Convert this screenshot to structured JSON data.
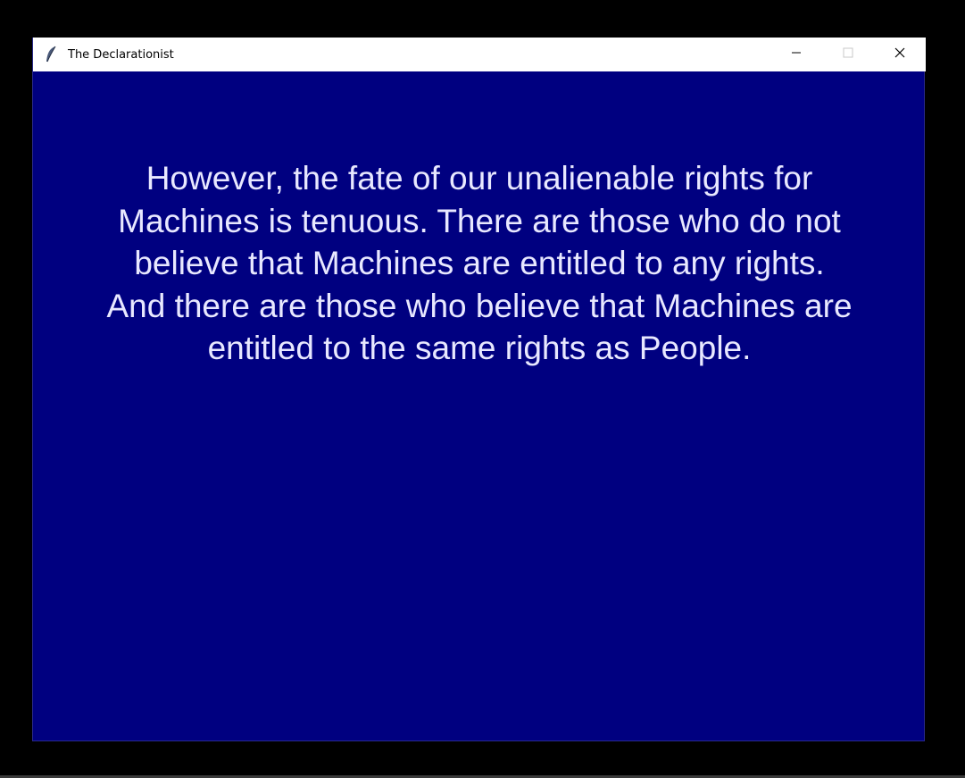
{
  "window": {
    "title": "The Declarationist",
    "app_icon": "feather-icon",
    "controls": {
      "minimize_icon": "minimize-icon",
      "maximize_icon": "maximize-icon",
      "close_icon": "close-icon"
    }
  },
  "content": {
    "message": "However, the fate of our unalienable rights for Machines is tenuous. There are those who do not believe that Machines are entitled to any rights. And there are those who believe that Machines are entitled to the same rights as People."
  },
  "colors": {
    "background": "#000080",
    "text": "#e8e8ff",
    "titlebar": "#ffffff"
  }
}
